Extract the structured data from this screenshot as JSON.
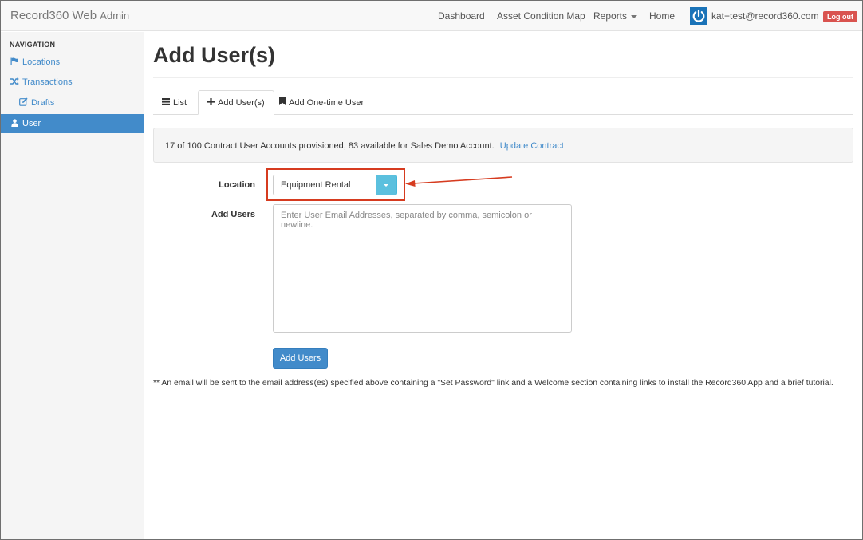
{
  "navbar": {
    "brand": "Record360 Web",
    "brand_sub": "Admin",
    "links": [
      "Dashboard",
      "Asset Condition Map",
      "Reports",
      "Home"
    ],
    "user_email": "kat+test@record360.com",
    "logout_label": "Log out"
  },
  "sidebar": {
    "header": "NAVIGATION",
    "items": [
      {
        "label": "Locations",
        "icon": "flag-icon"
      },
      {
        "label": "Transactions",
        "icon": "shuffle-icon"
      },
      {
        "label": "Drafts",
        "icon": "edit-icon"
      },
      {
        "label": "User",
        "icon": "user-icon",
        "active": true
      }
    ]
  },
  "main": {
    "title": "Add User(s)",
    "tabs": [
      {
        "label": "List",
        "icon": "list-icon"
      },
      {
        "label": "Add User(s)",
        "icon": "plus-icon",
        "active": true
      },
      {
        "label": "Add One-time User",
        "icon": "bookmark-icon"
      }
    ],
    "notice": "17 of 100 Contract User Accounts provisioned, 83 available for Sales Demo Account.",
    "notice_link": "Update Contract",
    "form": {
      "location_label": "Location",
      "location_value": "Equipment Rental",
      "users_label": "Add Users",
      "users_placeholder": "Enter User Email Addresses, separated by comma, semicolon or newline.",
      "submit_label": "Add Users"
    },
    "footnote": "** An email will be sent to the email address(es) specified above containing a \"Set Password\" link and a Welcome section containing links to install the Record360 App and a brief tutorial."
  },
  "colors": {
    "primary": "#428bca",
    "info": "#5bc0de",
    "danger": "#d9534f",
    "annotation": "#d63b1f"
  }
}
